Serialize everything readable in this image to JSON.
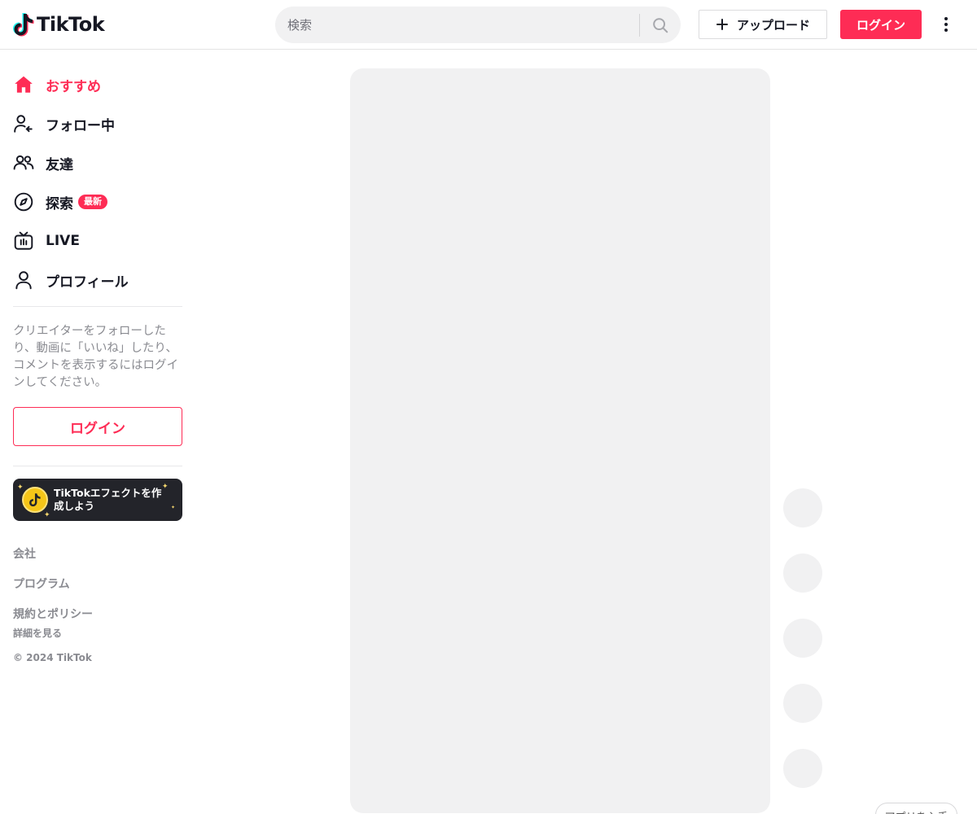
{
  "header": {
    "logo_text": "TikTok",
    "search_placeholder": "検索",
    "upload_label": "アップロード",
    "login_label": "ログイン"
  },
  "sidebar": {
    "nav": [
      {
        "label": "おすすめ",
        "icon": "home-icon",
        "active": true
      },
      {
        "label": "フォロー中",
        "icon": "following-icon"
      },
      {
        "label": "友達",
        "icon": "friends-icon"
      },
      {
        "label": "探索",
        "icon": "explore-icon",
        "badge": "最新"
      },
      {
        "label": "LIVE",
        "icon": "live-icon"
      },
      {
        "label": "プロフィール",
        "icon": "profile-icon"
      }
    ],
    "login_prompt": "クリエイターをフォローしたり、動画に「いいね」したり、コメントを表示するにはログインしてください。",
    "login_button": "ログイン",
    "effect_banner": "TikTokエフェクトを作成しよう",
    "footer": {
      "company": "会社",
      "program": "プログラム",
      "terms": "規約とポリシー",
      "see_more": "詳細を見る",
      "copyright": "© 2024 TikTok"
    }
  },
  "main": {
    "get_app_label": "アプリを入手"
  },
  "colors": {
    "accent": "#fe2c55",
    "placeholder_gray": "#f1f1f2",
    "text_primary": "#161823",
    "text_secondary": "#8a8b91"
  }
}
